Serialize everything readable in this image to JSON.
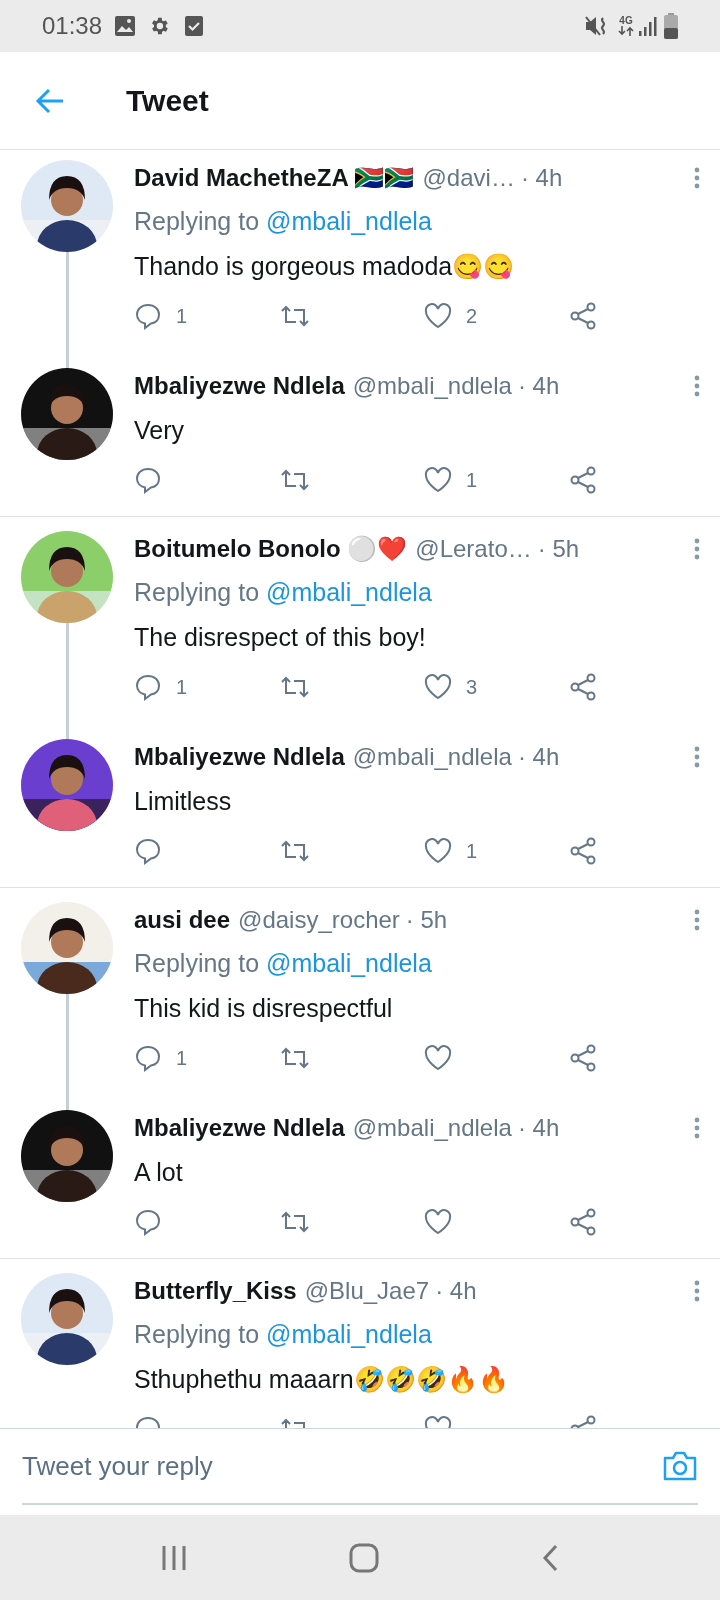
{
  "status_bar": {
    "time": "01:38",
    "network": "4G"
  },
  "header": {
    "title": "Tweet"
  },
  "threads": [
    {
      "tweets": [
        {
          "name": "David MachetheZA 🇿🇦🇿🇦",
          "handle": "@davi…",
          "time": "· 4h",
          "replying_to_label": "Replying to",
          "replying_to": "@mbali_ndlela",
          "text": "Thando is gorgeous madoda😋😋",
          "reply_count": "1",
          "like_count": "2"
        },
        {
          "name": "Mbaliyezwe Ndlela",
          "handle": "@mbali_ndlela",
          "time": "· 4h",
          "text": "Very",
          "like_count": "1"
        }
      ]
    },
    {
      "tweets": [
        {
          "name": "Boitumelo Bonolo ⚪❤️",
          "handle": "@Lerato…",
          "time": "· 5h",
          "replying_to_label": "Replying to",
          "replying_to": "@mbali_ndlela",
          "text": "The disrespect of this boy!",
          "reply_count": "1",
          "like_count": "3"
        },
        {
          "name": "Mbaliyezwe Ndlela",
          "handle": "@mbali_ndlela",
          "time": "· 4h",
          "text": "Limitless",
          "like_count": "1"
        }
      ]
    },
    {
      "tweets": [
        {
          "name": "ausi dee",
          "handle": "@daisy_rocher",
          "time": "· 5h",
          "replying_to_label": "Replying to",
          "replying_to": "@mbali_ndlela",
          "text": "This kid is disrespectful",
          "reply_count": "1"
        },
        {
          "name": "Mbaliyezwe Ndlela",
          "handle": "@mbali_ndlela",
          "time": "· 4h",
          "text": "A lot"
        }
      ]
    },
    {
      "tweets": [
        {
          "name": "Butterfly_Kiss",
          "handle": "@Blu_Jae7",
          "time": "· 4h",
          "replying_to_label": "Replying to",
          "replying_to": "@mbali_ndlela",
          "text": "Sthuphethu maaarn🤣🤣🤣🔥🔥"
        }
      ]
    }
  ],
  "reply_bar": {
    "placeholder": "Tweet your reply"
  }
}
